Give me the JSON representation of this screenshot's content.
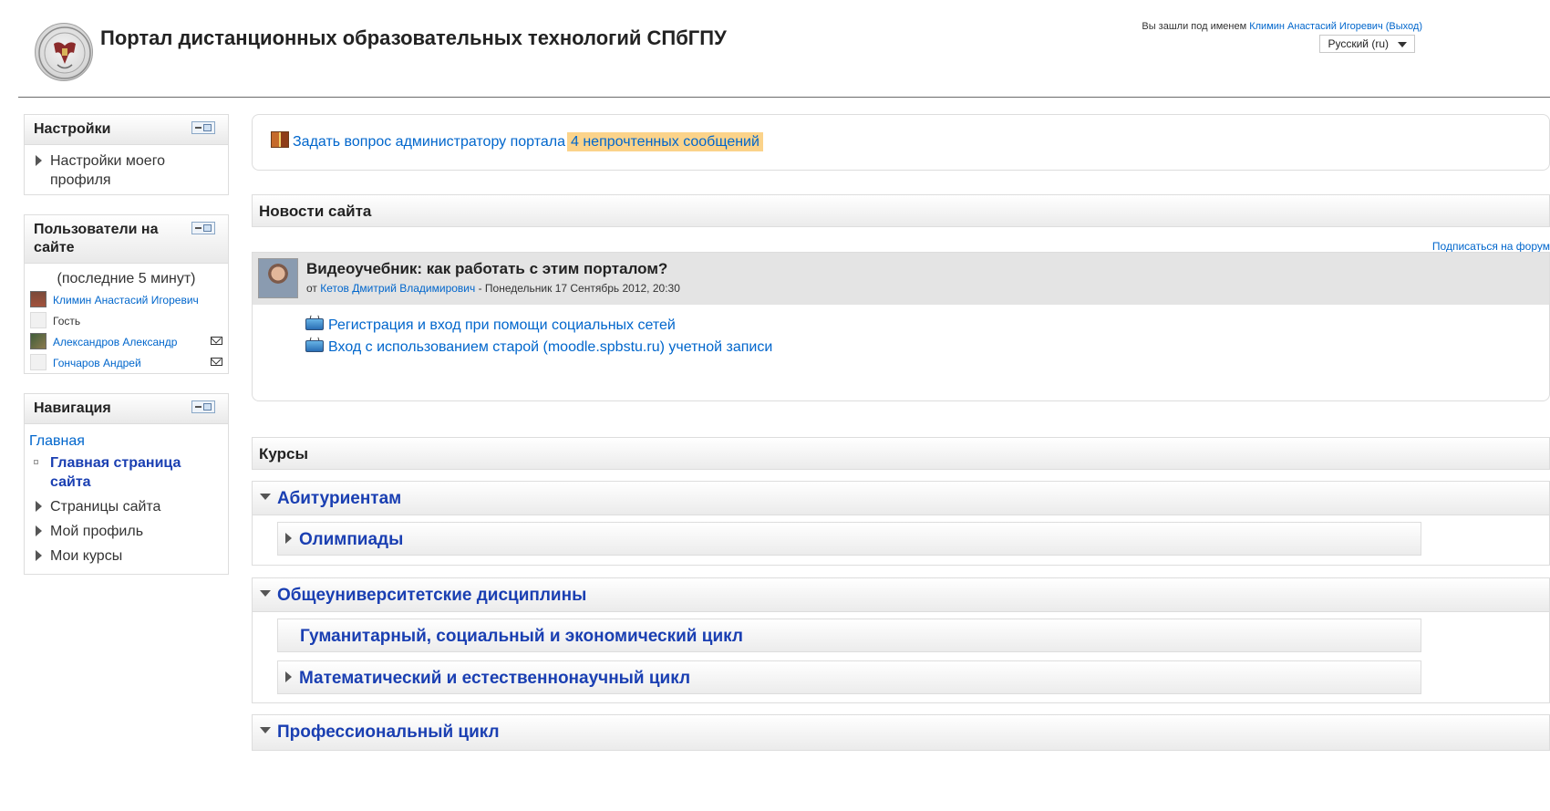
{
  "header": {
    "site_title": "Портал дистанционных образовательных технологий СПбГПУ",
    "login_prefix": "Вы зашли под именем ",
    "login_user": "Климин Анастасий Игоревич",
    "logout_label": "(Выход)",
    "language": "Русский (ru)"
  },
  "settings_block": {
    "title": "Настройки",
    "items": [
      {
        "label": "Настройки моего профиля"
      }
    ]
  },
  "online_users_block": {
    "title": "Пользователи на сайте",
    "subtitle": "(последние 5 минут)",
    "users": [
      {
        "name": "Климин Анастасий Игоревич"
      },
      {
        "name": "Гость"
      },
      {
        "name": "Александров Александр"
      },
      {
        "name": "Гончаров Андрей"
      }
    ]
  },
  "navigation_block": {
    "title": "Навигация",
    "home": "Главная",
    "items": [
      {
        "label": "Главная страница сайта"
      },
      {
        "label": "Страницы сайта"
      },
      {
        "label": "Мой профиль"
      },
      {
        "label": "Мои курсы"
      }
    ]
  },
  "ask_admin": {
    "link": "Задать вопрос администратору портала",
    "unread": "4 непрочтенных сообщений"
  },
  "news": {
    "title": "Новости сайта",
    "subscribe": "Подписаться на форум",
    "post": {
      "subject": "Видеоучебник: как работать с этим порталом?",
      "by": "от ",
      "author": "Кетов Дмитрий Владимирович",
      "date": " - Понедельник 17 Сентябрь 2012, 20:30",
      "links": [
        "Регистрация и вход при помощи социальных сетей",
        "Вход с использованием старой (moodle.spbstu.ru) учетной записи"
      ]
    }
  },
  "courses": {
    "title": "Курсы",
    "categories": [
      {
        "name": "Абитуриентам",
        "subcategories": [
          {
            "name": "Олимпиады"
          }
        ]
      },
      {
        "name": "Общеуниверситетские дисциплины",
        "subcategories": [
          {
            "name": "Гуманитарный, социальный и экономический цикл"
          },
          {
            "name": "Математический и естественнонаучный цикл"
          }
        ]
      },
      {
        "name": "Профессиональный цикл"
      }
    ]
  },
  "colors": {
    "link": "#0066cc",
    "category": "#1a3fb2",
    "highlight": "#fbd38a"
  }
}
